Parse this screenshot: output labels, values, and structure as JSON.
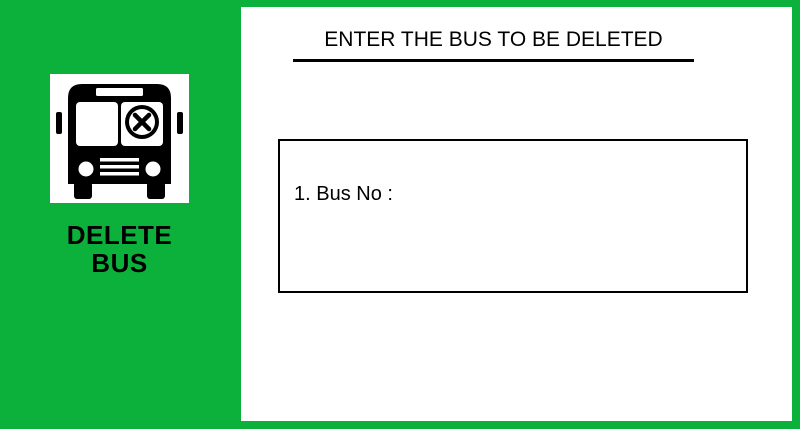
{
  "sidebar": {
    "icon": "bus-delete-icon",
    "title_line1": "DELETE",
    "title_line2": "BUS"
  },
  "main": {
    "heading": "ENTER THE BUS TO BE DELETED",
    "fields": [
      {
        "label": "1. Bus No :",
        "value": "",
        "placeholder": ""
      }
    ]
  },
  "colors": {
    "background": "#0bb13b",
    "panel": "#ffffff",
    "ink": "#000000"
  }
}
